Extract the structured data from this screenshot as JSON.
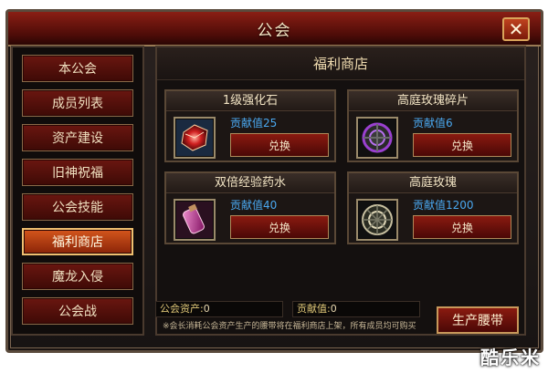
{
  "window": {
    "title": "公会",
    "close_label": "✕"
  },
  "sidebar": {
    "items": [
      {
        "label": "本公会"
      },
      {
        "label": "成员列表"
      },
      {
        "label": "资产建设"
      },
      {
        "label": "旧神祝福"
      },
      {
        "label": "公会技能"
      },
      {
        "label": "福利商店",
        "active": true
      },
      {
        "label": "魔龙入侵"
      },
      {
        "label": "公会战"
      }
    ]
  },
  "shop": {
    "title": "福利商店",
    "items": [
      {
        "name": "1级强化石",
        "cost": "贡献值25",
        "button": "兑换",
        "icon": "red-gem-icon"
      },
      {
        "name": "高庭玫瑰碎片",
        "cost": "贡献值6",
        "button": "兑换",
        "icon": "rose-fragment-icon"
      },
      {
        "name": "双倍经验药水",
        "cost": "贡献值40",
        "button": "兑换",
        "icon": "potion-icon"
      },
      {
        "name": "高庭玫瑰",
        "cost": "贡献值1200",
        "button": "兑换",
        "icon": "rose-emblem-icon"
      }
    ]
  },
  "footer": {
    "assets_label": "公会资产:",
    "assets_value": "0",
    "contribution_label": "贡献值:",
    "contribution_value": "0",
    "notice": "※会长消耗公会资产生产的腰带将在福利商店上架，所有成员均可购买",
    "produce_button": "生产腰带"
  },
  "watermark": "酷乐米",
  "colors": {
    "accent_red": "#8a1a10",
    "highlight_orange": "#d4561c",
    "cost_blue": "#4aa8f0"
  }
}
